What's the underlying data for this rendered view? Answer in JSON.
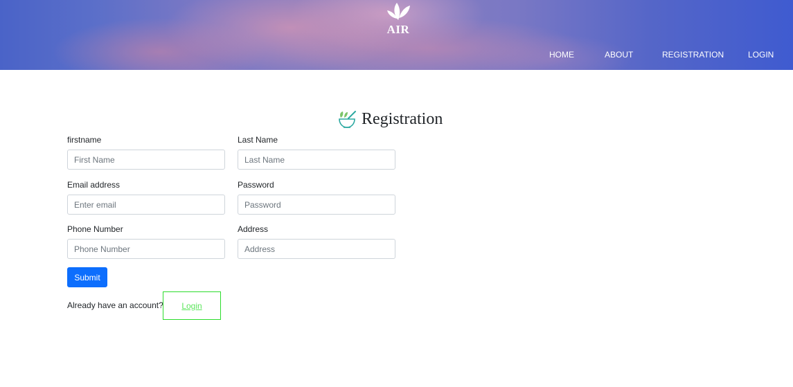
{
  "brand": {
    "name": "AIR",
    "logo_icon": "leaf-icon"
  },
  "nav": {
    "home": "HOME",
    "about": "ABOUT",
    "registration": "REGISTRATION",
    "login": "LOGIN"
  },
  "page": {
    "title": "Registration",
    "title_icon": "herbal-bowl-icon"
  },
  "form": {
    "firstname": {
      "label": "firstname",
      "placeholder": "First Name"
    },
    "lastname": {
      "label": "Last Name",
      "placeholder": "Last Name"
    },
    "email": {
      "label": "Email address",
      "placeholder": "Enter email"
    },
    "password": {
      "label": "Password",
      "placeholder": "Password"
    },
    "phone": {
      "label": "Phone Number",
      "placeholder": "Phone Number"
    },
    "address": {
      "label": "Address",
      "placeholder": "Address"
    },
    "submit_label": "Submit"
  },
  "footer": {
    "prompt": "Already have an account?",
    "login_link": "Login"
  },
  "colors": {
    "primary_button": "#0d6efd",
    "login_link": "#5ce65c",
    "login_box_border": "#2bdc2b",
    "header_blue": "#4a63c8"
  }
}
